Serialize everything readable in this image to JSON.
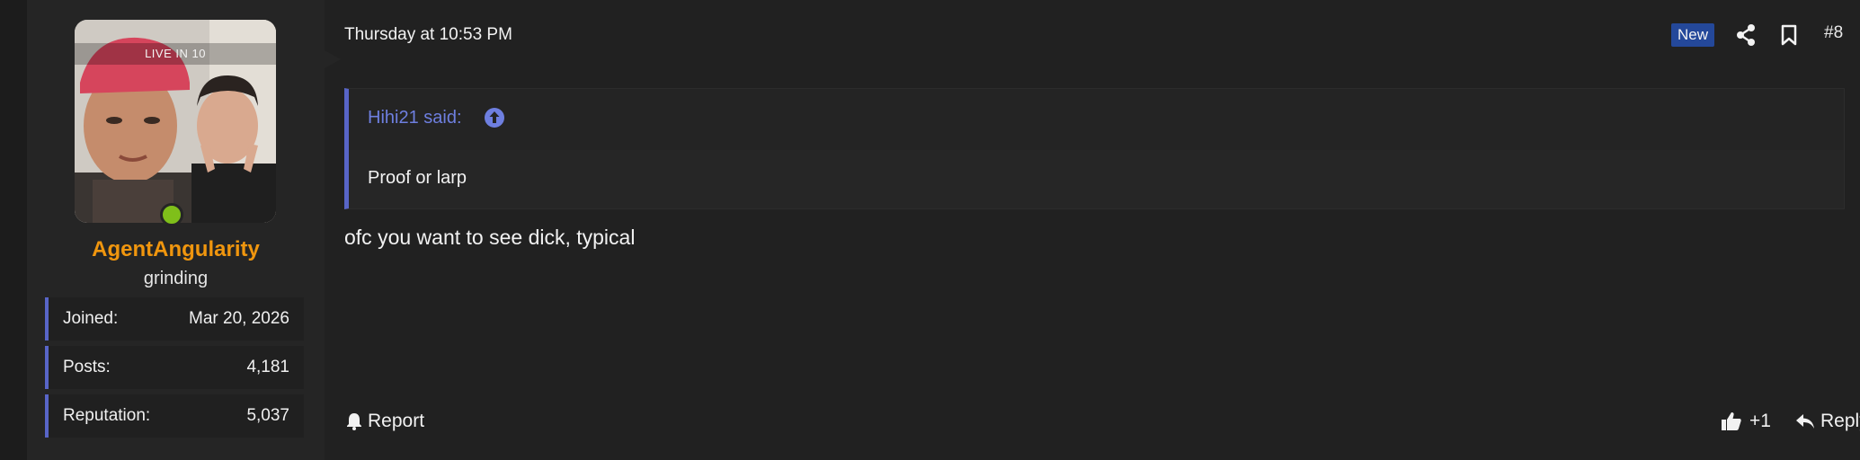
{
  "user": {
    "avatar_overlay": "LIVE IN 10",
    "username": "AgentAngularity",
    "title": "grinding",
    "stats": [
      {
        "label": "Joined:",
        "value": "Mar 20, 2026"
      },
      {
        "label": "Posts:",
        "value": "4,181"
      },
      {
        "label": "Reputation:",
        "value": "5,037"
      }
    ]
  },
  "post": {
    "date": "Thursday at 10:53 PM",
    "badge": "New",
    "number": "#8",
    "quote": {
      "author_line": "Hihi21 said:",
      "text": "Proof or larp"
    },
    "message": "ofc you want to see dick, typical"
  },
  "actions": {
    "report": "Report",
    "like_count": "+1",
    "reply": "Reply"
  },
  "colors": {
    "username": "#f0960e",
    "accent": "#5865c7",
    "quote_author": "#6e7fe0",
    "new_badge": "#24489a",
    "online": "#7fbf1a"
  },
  "icons": [
    "share-icon",
    "bookmark-icon",
    "quote-arrow-up-icon",
    "bell-icon",
    "thumbs-up-icon",
    "reply-arrow-icon"
  ]
}
